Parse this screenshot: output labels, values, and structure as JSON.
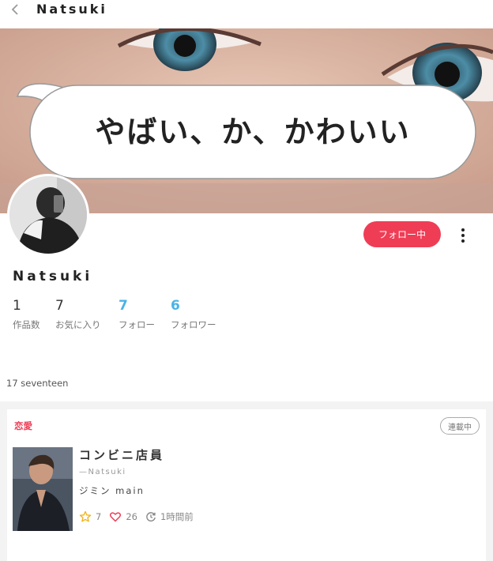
{
  "header": {
    "title": "Natsuki"
  },
  "cover": {
    "speech_text": "やばい、か、かわいい"
  },
  "profile": {
    "name": "Natsuki",
    "follow_label": "フォロー中",
    "bio": "17 seventeen"
  },
  "stats": [
    {
      "value": "1",
      "label": "作品数"
    },
    {
      "value": "7",
      "label": "お気に入り"
    },
    {
      "value": "7",
      "label": "フォロー"
    },
    {
      "value": "6",
      "label": "フォロワー"
    }
  ],
  "story": {
    "genre": "恋愛",
    "status": "連載中",
    "title": "コンビニ店員",
    "author": "—Natsuki",
    "description": "ジミン main",
    "stars": "7",
    "hearts": "26",
    "updated": "1時間前"
  },
  "colors": {
    "accent": "#ef3d56",
    "link": "#4ab3e6"
  }
}
